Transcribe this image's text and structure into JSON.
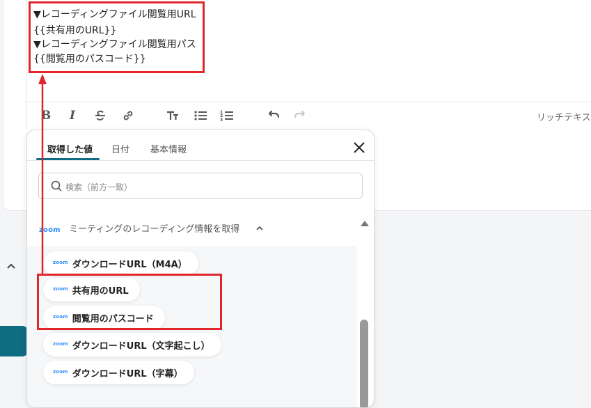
{
  "editor": {
    "lines": [
      "▼レコーディングファイル閲覧用URL",
      "{{共有用のURL}}",
      "▼レコーディングファイル閲覧用パス",
      "{{閲覧用のパスコード}}"
    ],
    "toolbar": {
      "mode_label": "リッチテキス"
    }
  },
  "picker": {
    "tabs": [
      "取得した値",
      "日付",
      "基本情報"
    ],
    "active_tab": "取得した値",
    "search_placeholder": "検索（前方一致）",
    "group": {
      "app_logo": "zoom",
      "label": "ミーティングのレコーディング情報を取得"
    },
    "items": [
      "ダウンロードURL（M4A）",
      "共有用のURL",
      "閲覧用のパスコード",
      "ダウンロードURL（文字起こし）",
      "ダウンロードURL（字幕）"
    ],
    "item_logo": "zoom"
  },
  "colors": {
    "accent": "#0e6d82",
    "annotation": "#e0262a",
    "zoom_blue": "#2d8cff"
  }
}
